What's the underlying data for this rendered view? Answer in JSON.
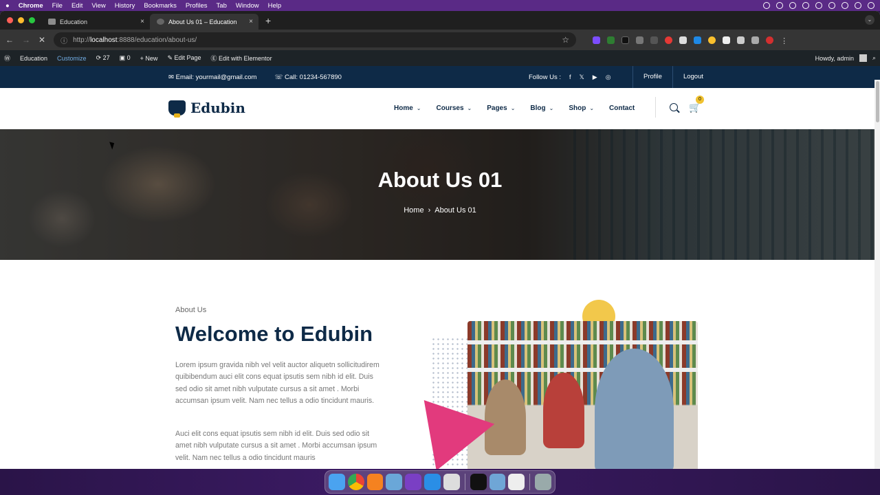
{
  "macos_menu": {
    "apple": "",
    "app": "Chrome",
    "items": [
      "File",
      "Edit",
      "View",
      "History",
      "Bookmarks",
      "Profiles",
      "Tab",
      "Window",
      "Help"
    ]
  },
  "browser": {
    "tabs": [
      {
        "title": "Education",
        "active": false
      },
      {
        "title": "About Us 01 – Education",
        "active": true
      }
    ],
    "url_prefix": "http://",
    "url_host": "localhost",
    "url_rest": ":8888/education/about-us/",
    "new_tab": "+",
    "close": "×"
  },
  "wp_admin": {
    "site": "Education",
    "customize": "Customize",
    "updates": "27",
    "comments": "0",
    "new": "New",
    "edit_page": "Edit Page",
    "elementor": "Edit with Elementor",
    "howdy": "Howdy, admin"
  },
  "topbar": {
    "email": "Email: yourmail@gmail.com",
    "call": "Call: 01234-567890",
    "follow": "Follow Us :",
    "social": [
      "f",
      "𝕏",
      "▶",
      "◎"
    ],
    "profile": "Profile",
    "logout": "Logout"
  },
  "header": {
    "logo": "Edubin",
    "nav": [
      "Home",
      "Courses",
      "Pages",
      "Blog",
      "Shop",
      "Contact"
    ],
    "cart_count": "0"
  },
  "hero": {
    "title": "About Us 01",
    "crumb_home": "Home",
    "crumb_sep": "›",
    "crumb_current": "About Us 01"
  },
  "about": {
    "subtitle": "About Us",
    "heading": "Welcome to Edubin",
    "p1": "Lorem ipsum gravida nibh vel velit auctor aliquetn sollicitudirem quibibendum auci elit cons equat ipsutis sem nibh id elit. Duis sed odio sit amet nibh vulputate cursus a sit amet . Morbi accumsan ipsum velit. Nam nec tellus a odio tincidunt mauris.",
    "p2": "Auci elit cons equat ipsutis sem nibh id elit. Duis sed odio sit amet nibh vulputate cursus a sit amet . Morbi accumsan ipsum velit. Nam nec tellus a odio tincidunt mauris"
  },
  "colors": {
    "navy": "#0e2a47",
    "accent_yellow": "#f2c84b",
    "accent_pink": "#e23a7d",
    "wp_bar": "#1d2327"
  }
}
